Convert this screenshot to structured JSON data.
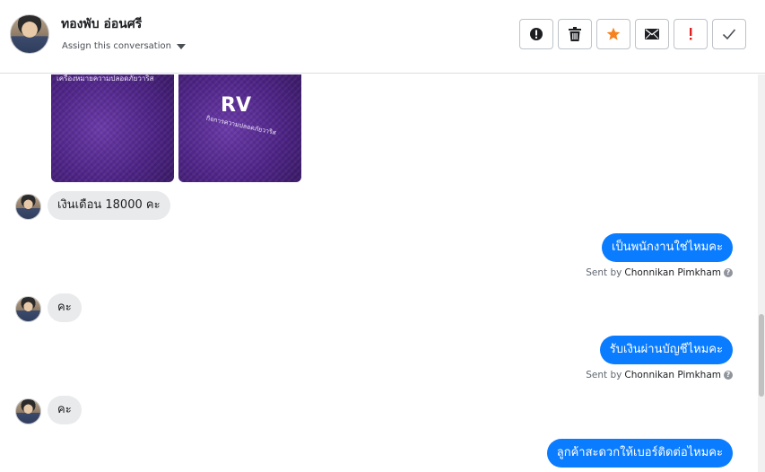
{
  "header": {
    "contact_name": "ทองพับ อ่อนศรี",
    "assign_label": "Assign this conversation",
    "toolbar": [
      {
        "name": "report-spam-button",
        "icon": "alert-circle-icon"
      },
      {
        "name": "delete-button",
        "icon": "trash-icon"
      },
      {
        "name": "star-button",
        "icon": "star-icon"
      },
      {
        "name": "mark-unread-button",
        "icon": "envelope-icon"
      },
      {
        "name": "mark-important-button",
        "icon": "exclamation-icon"
      },
      {
        "name": "mark-done-button",
        "icon": "checkmark-icon"
      }
    ]
  },
  "images": {
    "photo1_caption": "เครื่องหมายความปลอดภัยวาริส",
    "photo2_logo": "RV",
    "photo2_caption": "กิจการความปลอดภัยวาริส"
  },
  "messages": [
    {
      "direction": "in",
      "text": "เงินเดือน 18000 คะ"
    },
    {
      "direction": "out",
      "text": "เป็นพนักงานใช่ไหมคะ",
      "sent_by_prefix": "Sent by",
      "sent_by": "Chonnikan Pimkham"
    },
    {
      "direction": "in",
      "text": "คะ"
    },
    {
      "direction": "out",
      "text": "รับเงินผ่านบัญชีไหมคะ",
      "sent_by_prefix": "Sent by",
      "sent_by": "Chonnikan Pimkham"
    },
    {
      "direction": "in",
      "text": "คะ"
    },
    {
      "direction": "out",
      "text": "ลูกค้าสะดวกให้เบอร์ติดต่อไหมคะ"
    }
  ],
  "colors": {
    "outgoing_bubble": "#0a7cff",
    "incoming_bubble": "#e9eaeb",
    "star": "#f5821f",
    "important": "#e02020"
  }
}
